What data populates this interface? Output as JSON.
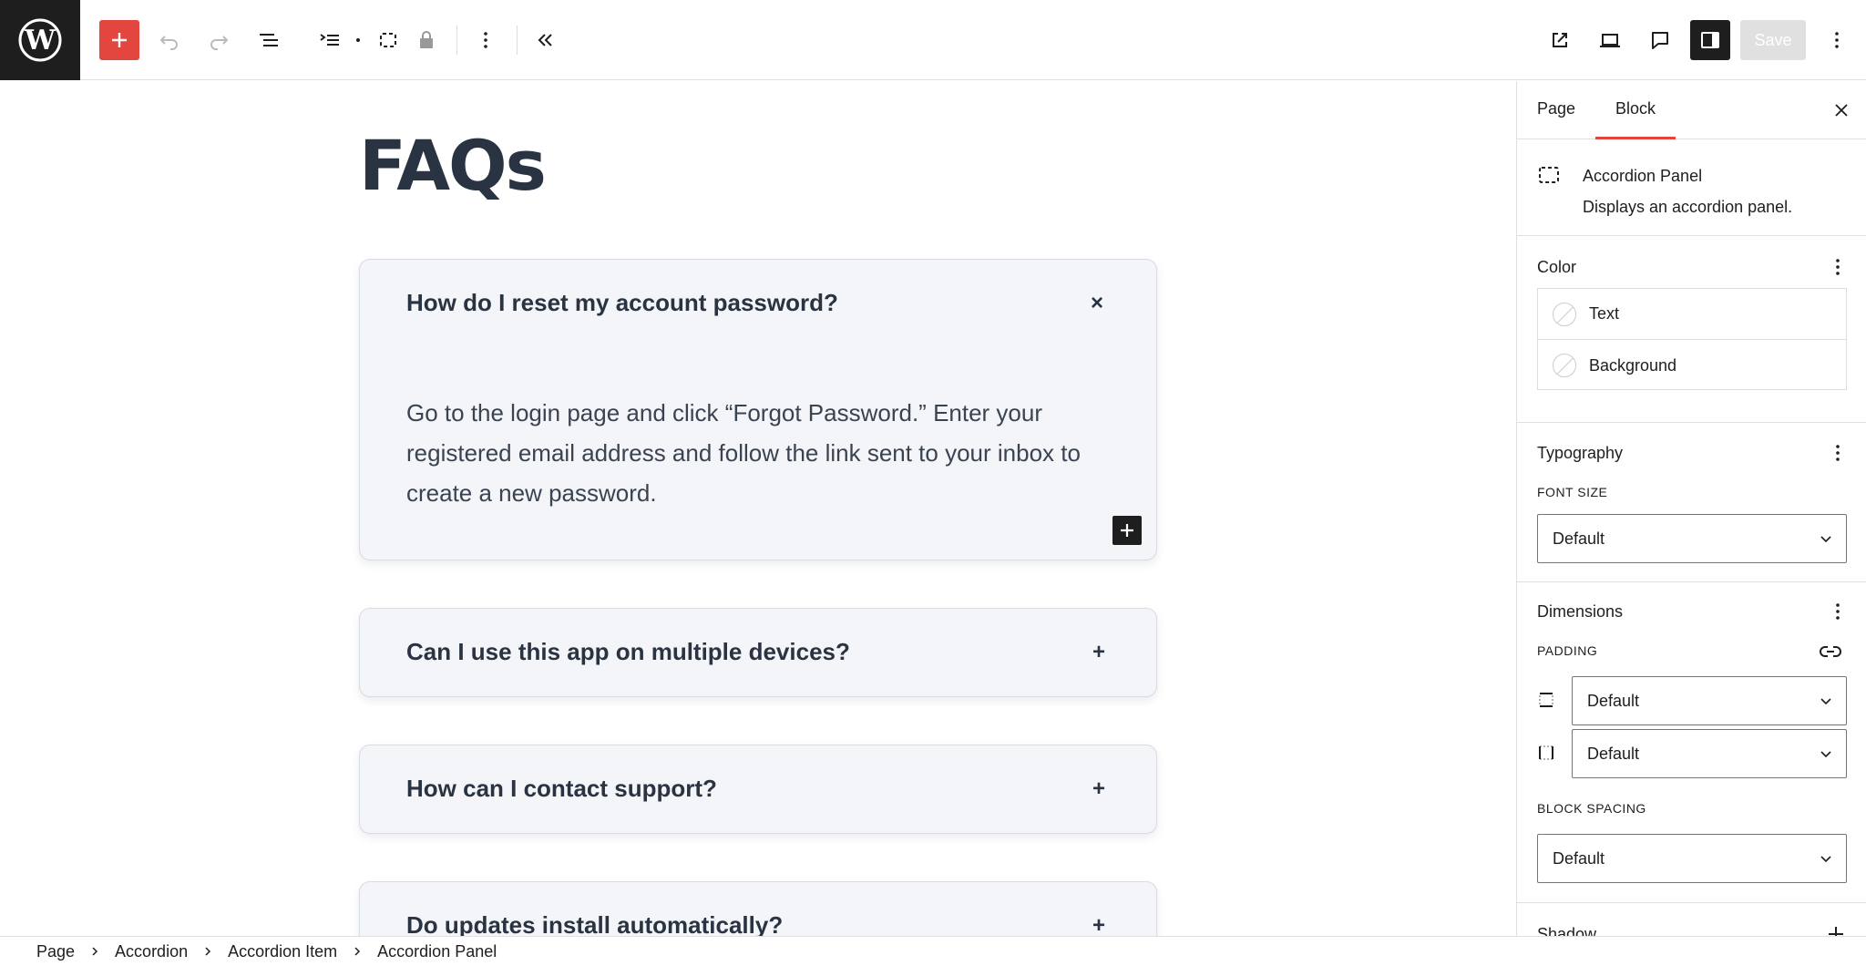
{
  "toolbar": {
    "save_label": "Save",
    "icons": [
      "wordpress-logo",
      "add-block",
      "undo",
      "redo",
      "document-overview",
      "block-navigation",
      "block-type",
      "lock",
      "more-options",
      "collapse",
      "view-page",
      "device-preview",
      "comments",
      "settings-sidebar",
      "options"
    ]
  },
  "canvas": {
    "page_title": "FAQs",
    "accordion": [
      {
        "question": "How do I reset my account password?",
        "expanded": true,
        "toggle_symbol": "×",
        "answer": "Go to the login page and click “Forgot Password.” Enter your registered email address and follow the link sent to your inbox to create a new password."
      },
      {
        "question": "Can I use this app on multiple devices?",
        "expanded": false,
        "toggle_symbol": "+"
      },
      {
        "question": "How can I contact support?",
        "expanded": false,
        "toggle_symbol": "+"
      },
      {
        "question": "Do updates install automatically?",
        "expanded": false,
        "toggle_symbol": "+"
      }
    ]
  },
  "sidebar": {
    "tabs": [
      {
        "label": "Page",
        "active": false
      },
      {
        "label": "Block",
        "active": true
      }
    ],
    "block_card": {
      "title": "Accordion Panel",
      "description": "Displays an accordion panel."
    },
    "color": {
      "title": "Color",
      "items": [
        {
          "label": "Text"
        },
        {
          "label": "Background"
        }
      ]
    },
    "typography": {
      "title": "Typography",
      "font_size_label": "FONT SIZE",
      "font_size_value": "Default"
    },
    "dimensions": {
      "title": "Dimensions",
      "padding_label": "PADDING",
      "padding_vertical": "Default",
      "padding_horizontal": "Default",
      "block_spacing_label": "BLOCK SPACING",
      "block_spacing_value": "Default"
    },
    "shadow": {
      "title": "Shadow"
    }
  },
  "breadcrumb": [
    "Page",
    "Accordion",
    "Accordion Item",
    "Accordion Panel"
  ],
  "colors": {
    "accent": "#e2463f",
    "dark": "#1e1e1e",
    "heading": "#2a3342",
    "accordion_bg": "#f4f5f9"
  }
}
